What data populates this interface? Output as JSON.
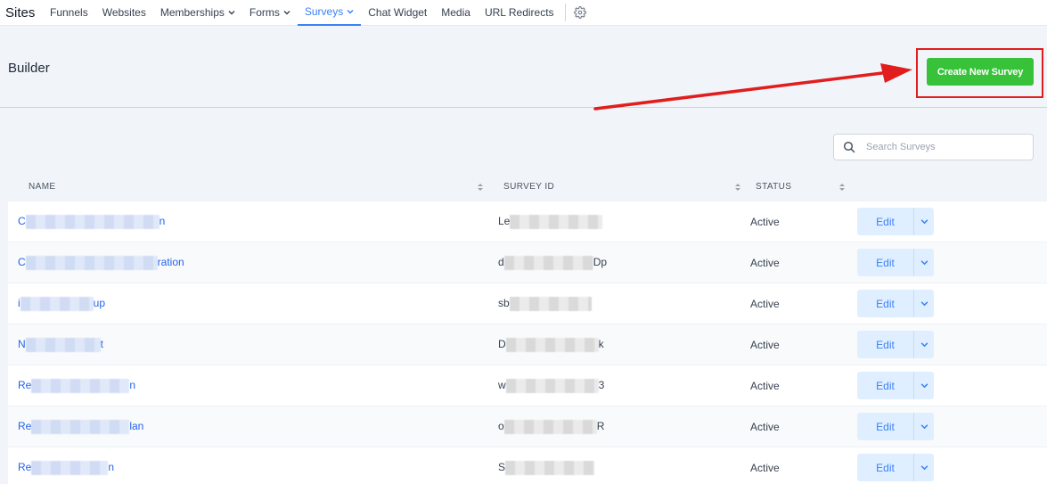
{
  "nav": {
    "brand": "Sites",
    "items": [
      {
        "label": "Funnels",
        "has_dropdown": false,
        "active": false
      },
      {
        "label": "Websites",
        "has_dropdown": false,
        "active": false
      },
      {
        "label": "Memberships",
        "has_dropdown": true,
        "active": false
      },
      {
        "label": "Forms",
        "has_dropdown": true,
        "active": false
      },
      {
        "label": "Surveys",
        "has_dropdown": true,
        "active": true
      },
      {
        "label": "Chat Widget",
        "has_dropdown": false,
        "active": false
      },
      {
        "label": "Media",
        "has_dropdown": false,
        "active": false
      },
      {
        "label": "URL Redirects",
        "has_dropdown": false,
        "active": false
      }
    ],
    "settings_icon": "gear-icon"
  },
  "page": {
    "title": "Builder",
    "create_button": "Create New Survey"
  },
  "search": {
    "placeholder": "Search Surveys"
  },
  "table": {
    "headers": {
      "name": "NAME",
      "survey_id": "SURVEY ID",
      "status": "STATUS"
    },
    "edit_label": "Edit",
    "rows": [
      {
        "name_start": "C",
        "name_end": "n",
        "id_start": "Le",
        "id_end": "",
        "status": "Active"
      },
      {
        "name_start": "C",
        "name_end": "ration",
        "id_start": "d",
        "id_end": "Dp",
        "status": "Active"
      },
      {
        "name_start": "i",
        "name_end": "up",
        "id_start": "sb",
        "id_end": "",
        "status": "Active"
      },
      {
        "name_start": "N",
        "name_end": "t",
        "id_start": "D",
        "id_end": "k",
        "status": "Active"
      },
      {
        "name_start": "Re",
        "name_end": "n",
        "id_start": "w",
        "id_end": "3",
        "status": "Active"
      },
      {
        "name_start": "Re",
        "name_end": "lan",
        "id_start": "o",
        "id_end": "R",
        "status": "Active"
      },
      {
        "name_start": "Re",
        "name_end": "n",
        "id_start": "S",
        "id_end": "",
        "status": "Active"
      }
    ]
  },
  "colors": {
    "accent": "#3b82f6",
    "create_button": "#37c23a",
    "annotation": "#e11d1d"
  }
}
